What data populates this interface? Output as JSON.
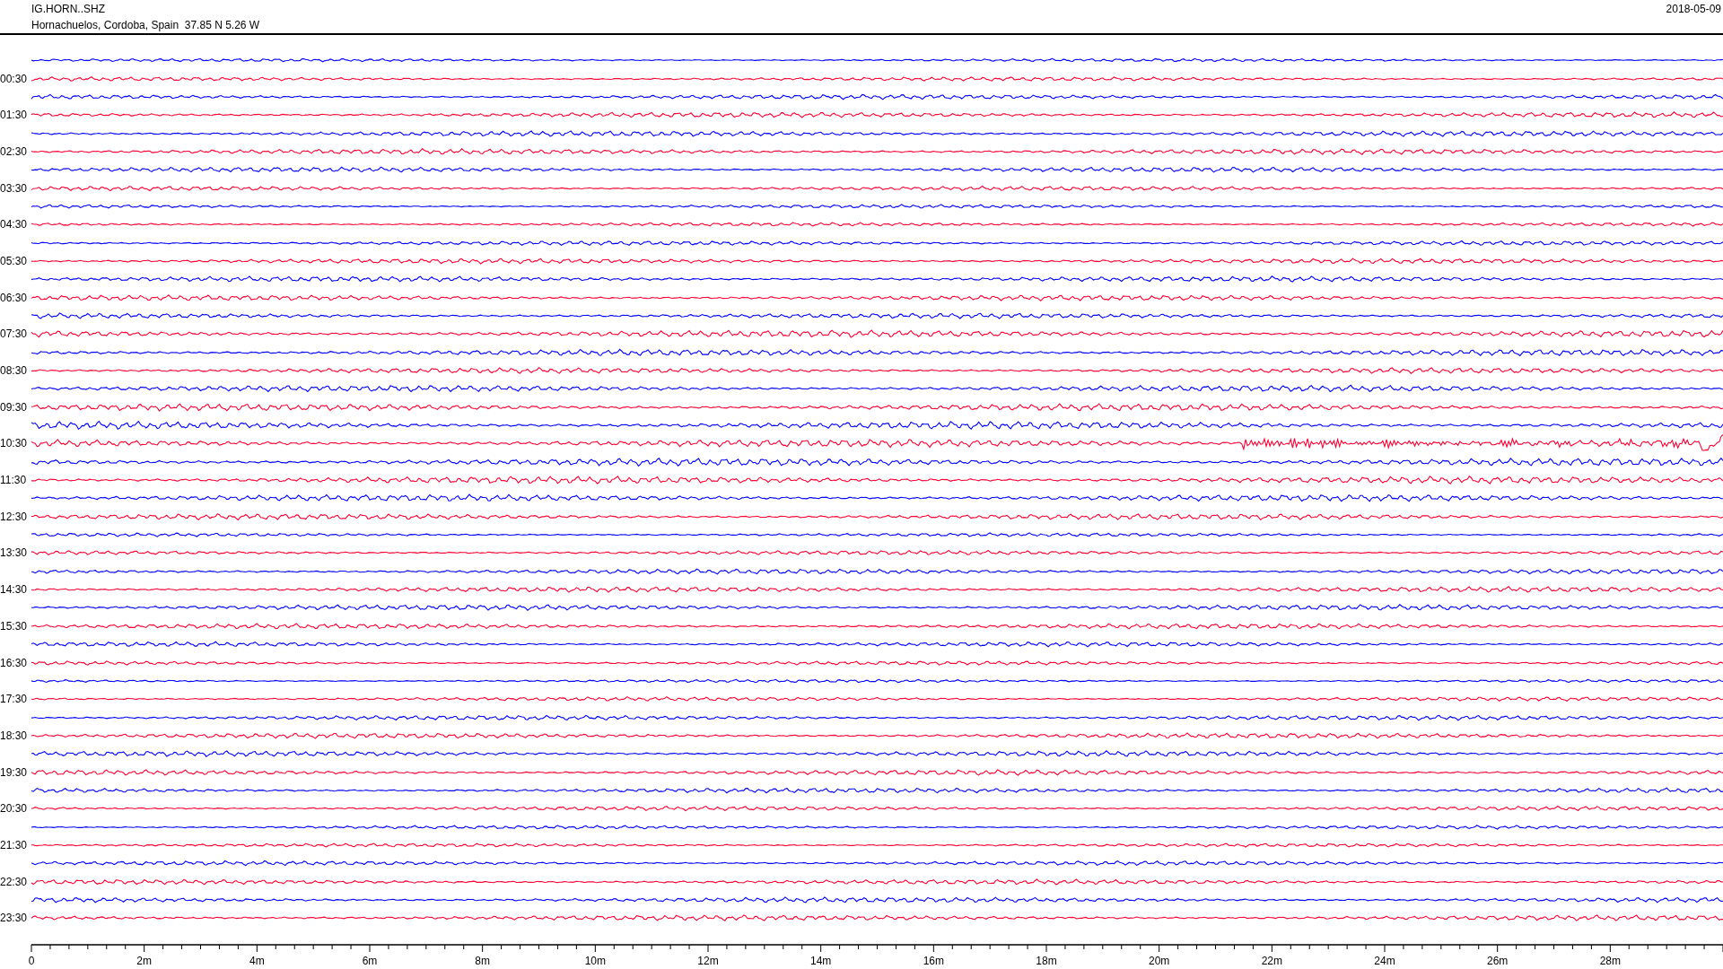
{
  "header": {
    "station": "IG.HORN..SHZ",
    "location": "Hornachuelos, Cordoba, Spain  37.85 N 5.26 W",
    "date": "2018-05-09"
  },
  "traces": [
    {
      "color": "#0000ff",
      "kind": "normal"
    },
    {
      "label": "00:30",
      "color": "#ff0033",
      "kind": "normal"
    },
    {
      "color": "#0000ff",
      "kind": "normal"
    },
    {
      "label": "01:30",
      "color": "#ff0033",
      "kind": "normal"
    },
    {
      "color": "#0000ff",
      "kind": "normal"
    },
    {
      "label": "02:30",
      "color": "#ff0033",
      "kind": "normal"
    },
    {
      "color": "#0000ff",
      "kind": "normal"
    },
    {
      "label": "03:30",
      "color": "#ff0033",
      "kind": "normal"
    },
    {
      "color": "#0000ff",
      "kind": "normal"
    },
    {
      "label": "04:30",
      "color": "#ff0033",
      "kind": "normal"
    },
    {
      "color": "#0000ff",
      "kind": "normal"
    },
    {
      "label": "05:30",
      "color": "#ff0033",
      "kind": "normal"
    },
    {
      "color": "#0000ff",
      "kind": "normal"
    },
    {
      "label": "06:30",
      "color": "#ff0033",
      "kind": "normal"
    },
    {
      "color": "#0000ff",
      "kind": "normal"
    },
    {
      "label": "07:30",
      "color": "#ff0033",
      "kind": "normal"
    },
    {
      "color": "#0000ff",
      "kind": "normal"
    },
    {
      "label": "08:30",
      "color": "#ff0033",
      "kind": "normal"
    },
    {
      "color": "#0000ff",
      "kind": "normal"
    },
    {
      "label": "09:30",
      "color": "#ff0033",
      "kind": "normal"
    },
    {
      "color": "#0000ff",
      "kind": "normal"
    },
    {
      "label": "10:30",
      "color": "#ff0033",
      "kind": "event"
    },
    {
      "color": "#0000ff",
      "kind": "normal"
    },
    {
      "label": "11:30",
      "color": "#ff0033",
      "kind": "normal"
    },
    {
      "color": "#0000ff",
      "kind": "normal"
    },
    {
      "label": "12:30",
      "color": "#ff0033",
      "kind": "normal"
    },
    {
      "color": "#0000ff",
      "kind": "normal"
    },
    {
      "label": "13:30",
      "color": "#ff0033",
      "kind": "normal"
    },
    {
      "color": "#0000ff",
      "kind": "normal"
    },
    {
      "label": "14:30",
      "color": "#ff0033",
      "kind": "normal"
    },
    {
      "color": "#0000ff",
      "kind": "normal"
    },
    {
      "label": "15:30",
      "color": "#ff0033",
      "kind": "normal"
    },
    {
      "color": "#0000ff",
      "kind": "normal"
    },
    {
      "label": "16:30",
      "color": "#ff0033",
      "kind": "normal"
    },
    {
      "color": "#0000ff",
      "kind": "normal"
    },
    {
      "label": "17:30",
      "color": "#ff0033",
      "kind": "normal"
    },
    {
      "color": "#0000ff",
      "kind": "normal"
    },
    {
      "label": "18:30",
      "color": "#ff0033",
      "kind": "normal"
    },
    {
      "color": "#0000ff",
      "kind": "normal"
    },
    {
      "label": "19:30",
      "color": "#ff0033",
      "kind": "normal"
    },
    {
      "color": "#0000ff",
      "kind": "normal"
    },
    {
      "label": "20:30",
      "color": "#ff0033",
      "kind": "normal"
    },
    {
      "color": "#0000ff",
      "kind": "normal"
    },
    {
      "label": "21:30",
      "color": "#ff0033",
      "kind": "normal"
    },
    {
      "color": "#0000ff",
      "kind": "normal"
    },
    {
      "label": "22:30",
      "color": "#ff0033",
      "kind": "normal"
    },
    {
      "color": "#0000ff",
      "kind": "normal"
    },
    {
      "label": "23:30",
      "color": "#ff0033",
      "kind": "normal"
    }
  ],
  "x_axis": {
    "ticks": [
      "0",
      "2m",
      "4m",
      "6m",
      "8m",
      "10m",
      "12m",
      "14m",
      "16m",
      "18m",
      "20m",
      "22m",
      "24m",
      "26m",
      "28m"
    ]
  }
}
